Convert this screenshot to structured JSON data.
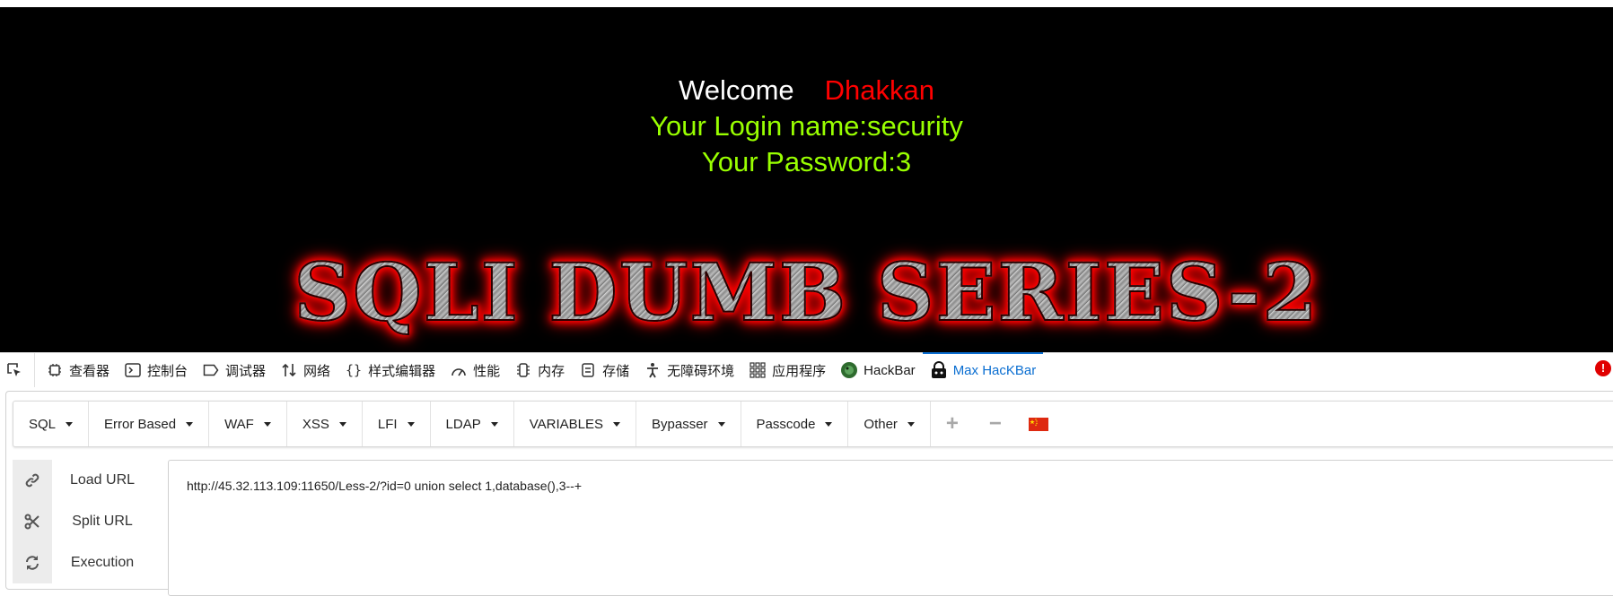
{
  "page": {
    "welcome": "Welcome",
    "user_name": "Dhakkan",
    "login_line": "Your Login name:security",
    "password_line": "Your Password:3",
    "banner": "SQLI DUMB SERIES-2"
  },
  "devtools": {
    "tabs": [
      {
        "label": "查看器",
        "icon": "inspector-icon"
      },
      {
        "label": "控制台",
        "icon": "console-icon"
      },
      {
        "label": "调试器",
        "icon": "debugger-icon"
      },
      {
        "label": "网络",
        "icon": "network-icon"
      },
      {
        "label": "样式编辑器",
        "icon": "style-editor-icon"
      },
      {
        "label": "性能",
        "icon": "performance-icon"
      },
      {
        "label": "内存",
        "icon": "memory-icon"
      },
      {
        "label": "存储",
        "icon": "storage-icon"
      },
      {
        "label": "无障碍环境",
        "icon": "accessibility-icon"
      },
      {
        "label": "应用程序",
        "icon": "application-icon"
      },
      {
        "label": "HackBar",
        "icon": "hackbar-icon"
      },
      {
        "label": "Max HacKBar",
        "icon": "max-hackbar-icon",
        "active": true
      }
    ],
    "error_badge": "!",
    "active_color": "#0a6ed1"
  },
  "hackbar": {
    "menus": [
      "SQL",
      "Error Based",
      "WAF",
      "XSS",
      "LFI",
      "LDAP",
      "VARIABLES",
      "Bypasser",
      "Passcode",
      "Other"
    ],
    "add_symbol": "+",
    "remove_symbol": "−",
    "flag_icon": "china-flag-icon",
    "actions": [
      {
        "label": "Load URL",
        "icon": "link-icon"
      },
      {
        "label": "Split URL",
        "icon": "scissors-icon"
      },
      {
        "label": "Execution",
        "icon": "refresh-icon"
      }
    ],
    "url": "http://45.32.113.109:11650/Less-2/?id=0 union select 1,database(),3--+"
  },
  "colors": {
    "welcome_name": "#ff0000",
    "login_text": "#99ff00",
    "banner_glow": "#ff0000"
  }
}
